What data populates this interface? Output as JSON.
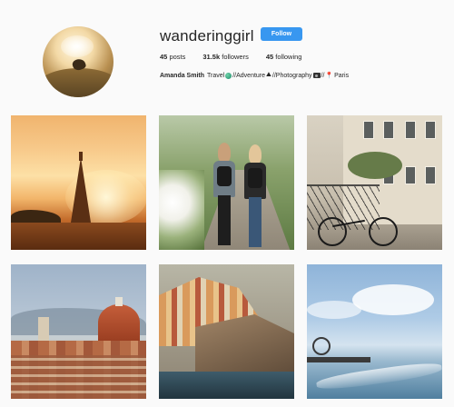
{
  "profile": {
    "username": "wanderinggirl",
    "follow_label": "Follow",
    "stats": [
      {
        "count": "45",
        "label": "posts"
      },
      {
        "count": "31.5k",
        "label": "followers"
      },
      {
        "count": "45",
        "label": "following"
      }
    ],
    "bio": {
      "name": "Amanda Smith",
      "segments": [
        "Travel",
        "//Adventure",
        "//Photography",
        "//",
        "Paris"
      ],
      "icons": [
        "globe-icon",
        "hiker-icon",
        "camera-icon",
        "pin-icon"
      ]
    }
  },
  "posts": [
    {
      "subject": "eiffel-tower-sunset"
    },
    {
      "subject": "two-girls-hiking-path"
    },
    {
      "subject": "paris-street-bicycle"
    },
    {
      "subject": "florence-skyline-duomo"
    },
    {
      "subject": "cliffside-village-sea"
    },
    {
      "subject": "beach-pier-ferris-wheel"
    }
  ],
  "colors": {
    "follow_button": "#3897f0",
    "background": "#fafafa",
    "text": "#262626"
  }
}
